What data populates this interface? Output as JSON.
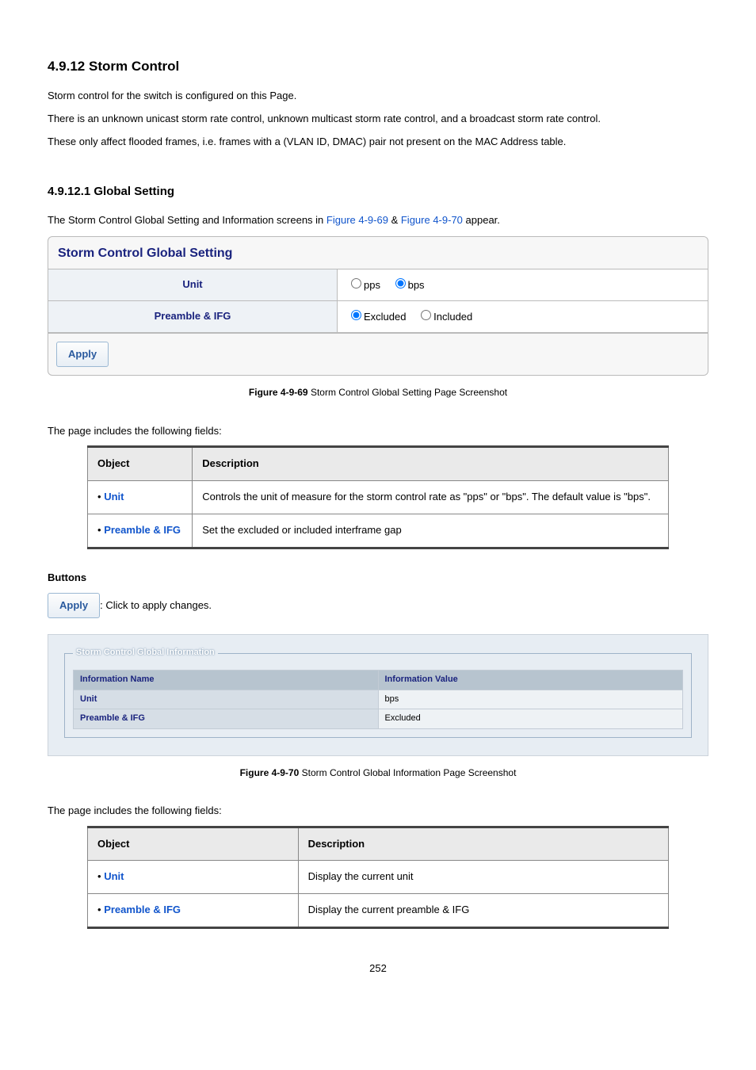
{
  "headings": {
    "section": "4.9.12 Storm Control",
    "subsection": "4.9.12.1 Global Setting"
  },
  "intro": {
    "p1": "Storm control for the switch is configured on this Page.",
    "p2": "There is an unknown unicast storm rate control, unknown multicast storm rate control, and a broadcast storm rate control.",
    "p3": "These only affect flooded frames, i.e. frames with a (VLAN ID, DMAC) pair not present on the MAC Address table."
  },
  "global_intro": {
    "pre": "The Storm Control Global Setting and Information screens in ",
    "link1": "Figure 4-9-69",
    "mid": " & ",
    "link2": "Figure 4-9-70",
    "post": " appear."
  },
  "panel": {
    "title": "Storm Control Global Setting",
    "row1_label": "Unit",
    "row1_opt1": "pps",
    "row1_opt2": "bps",
    "row2_label": "Preamble & IFG",
    "row2_opt1": "Excluded",
    "row2_opt2": "Included",
    "apply": "Apply"
  },
  "caption1": {
    "bold": "Figure 4-9-69 ",
    "rest": "Storm Control Global Setting Page Screenshot"
  },
  "fields_intro": "The page includes the following fields:",
  "table1": {
    "h1": "Object",
    "h2": "Description",
    "r1c1": "Unit",
    "r1c2": "Controls the unit of measure for the storm control rate as \"pps\" or \"bps\". The default value is \"bps\".",
    "r2c1": "Preamble & IFG",
    "r2c2": "Set the excluded or included interframe gap"
  },
  "buttons": {
    "heading": "Buttons",
    "apply": "Apply",
    "text": ": Click to apply changes."
  },
  "info_panel": {
    "legend": "Storm Control Global Information",
    "th1": "Information Name",
    "th2": "Information Value",
    "r1c1": "Unit",
    "r1c2": "bps",
    "r2c1": "Preamble & IFG",
    "r2c2": "Excluded"
  },
  "caption2": {
    "bold": "Figure 4-9-70 ",
    "rest": "Storm Control Global Information Page Screenshot"
  },
  "table2": {
    "h1": "Object",
    "h2": "Description",
    "r1c1": "Unit",
    "r1c2": "Display the current unit",
    "r2c1": "Preamble & IFG",
    "r2c2": "Display the current preamble & IFG"
  },
  "page_num": "252"
}
